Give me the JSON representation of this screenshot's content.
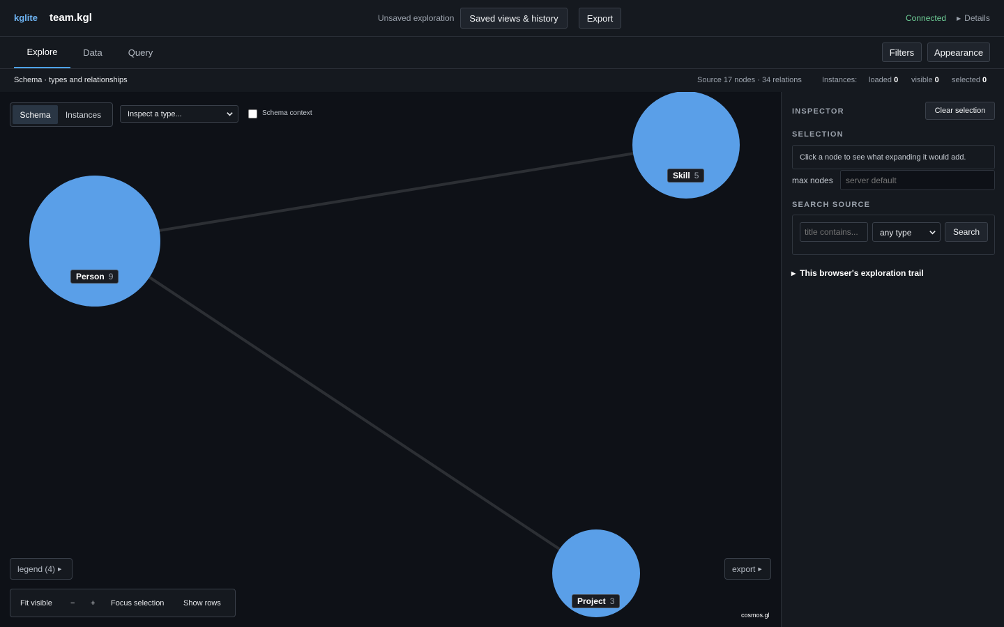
{
  "header": {
    "brand": "kglite",
    "file": "team.kgl",
    "unsaved": "Unsaved exploration",
    "saved_views": "Saved views & history",
    "export": "Export",
    "connected": "Connected",
    "details": "Details",
    "connected_color": "#6fcf97"
  },
  "tabs": [
    {
      "label": "Explore",
      "active": true
    },
    {
      "label": "Data",
      "active": false
    },
    {
      "label": "Query",
      "active": false
    }
  ],
  "toolbar_right": {
    "filters": "Filters",
    "appearance": "Appearance"
  },
  "status": {
    "breadcrumb": "Schema · types and relationships",
    "source": "Source 17 nodes · 34 relations",
    "instances_label": "Instances:",
    "loaded_label": "loaded",
    "loaded": "0",
    "visible_label": "visible",
    "visible": "0",
    "selected_label": "selected",
    "selected": "0"
  },
  "canvas": {
    "mode_schema": "Schema",
    "mode_instances": "Instances",
    "inspect_placeholder": "Inspect a type...",
    "schema_context": "Schema context",
    "legend": "legend (4)",
    "export": "export",
    "fit_visible": "Fit visible",
    "zoom_out": "−",
    "zoom_in": "+",
    "focus_selection": "Focus selection",
    "show_rows": "Show rows",
    "attribution": "cosmos.gl",
    "node_color": "#5a9fe8",
    "edge_color": "#2c2f34"
  },
  "graph": {
    "nodes": [
      {
        "id": "person",
        "label": "Person",
        "count": "9"
      },
      {
        "id": "skill",
        "label": "Skill",
        "count": "5"
      },
      {
        "id": "project",
        "label": "Project",
        "count": "3"
      }
    ],
    "edges": [
      {
        "from": "person",
        "to": "skill"
      },
      {
        "from": "person",
        "to": "project"
      }
    ]
  },
  "inspector": {
    "title": "INSPECTOR",
    "clear_selection": "Clear selection",
    "selection_title": "SELECTION",
    "selection_hint": "Click a node to see what expanding it would add.",
    "max_nodes_label": "max nodes",
    "max_nodes_placeholder": "server default",
    "search_title": "SEARCH SOURCE",
    "title_placeholder": "title contains...",
    "type_select": "any type",
    "search_button": "Search",
    "trail": "This browser's exploration trail"
  }
}
